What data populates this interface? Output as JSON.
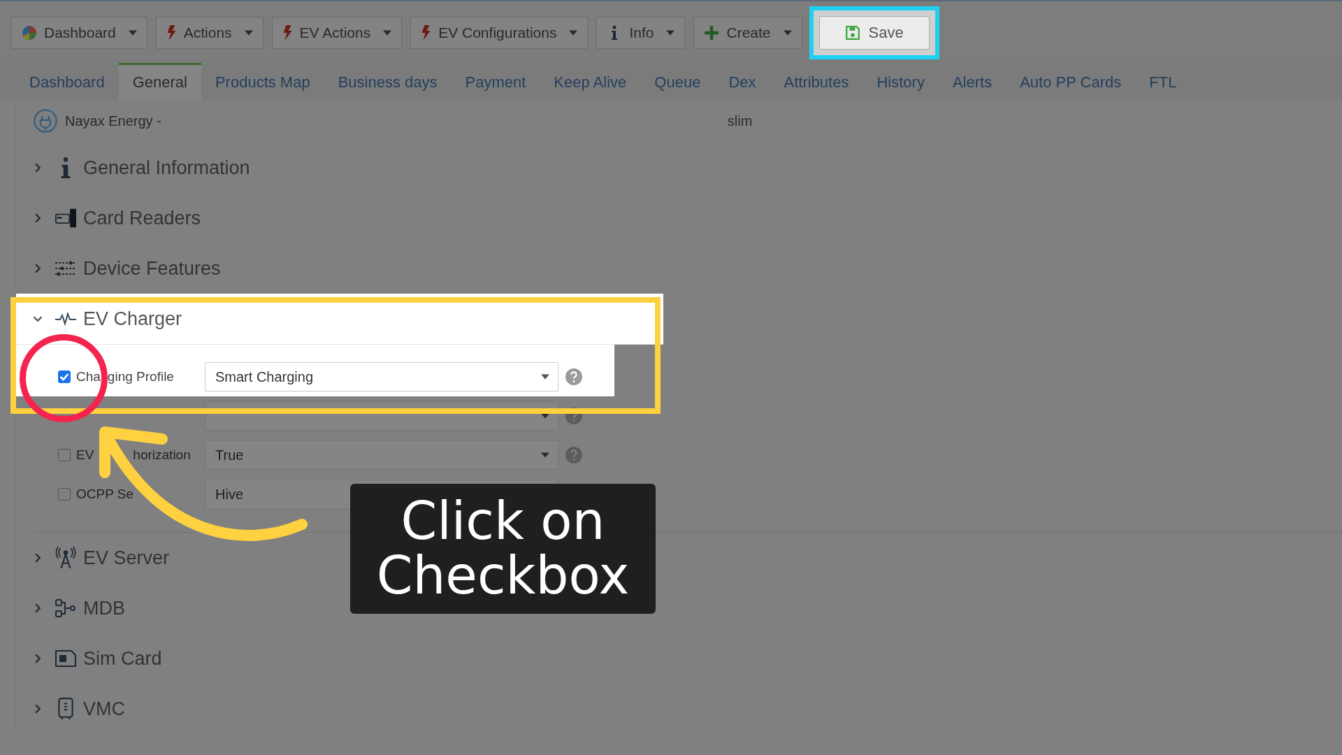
{
  "toolbar": [
    {
      "label": "Dashboard"
    },
    {
      "label": "Actions"
    },
    {
      "label": "EV Actions"
    },
    {
      "label": "EV Configurations"
    },
    {
      "label": "Info"
    },
    {
      "label": "Create"
    }
  ],
  "save_button": {
    "label": "Save"
  },
  "tabs": [
    {
      "label": "Dashboard",
      "selected": false
    },
    {
      "label": "General",
      "selected": true
    },
    {
      "label": "Products Map",
      "selected": false
    },
    {
      "label": "Business days",
      "selected": false
    },
    {
      "label": "Payment",
      "selected": false
    },
    {
      "label": "Keep Alive",
      "selected": false
    },
    {
      "label": "Queue",
      "selected": false
    },
    {
      "label": "Dex",
      "selected": false
    },
    {
      "label": "Attributes",
      "selected": false
    },
    {
      "label": "History",
      "selected": false
    },
    {
      "label": "Alerts",
      "selected": false
    },
    {
      "label": "Auto PP Cards",
      "selected": false
    },
    {
      "label": "FTL",
      "selected": false
    }
  ],
  "device": {
    "name": "Nayax Energy -",
    "model": "slim"
  },
  "sections": [
    {
      "title": "General Information",
      "expanded": false
    },
    {
      "title": "Card Readers",
      "expanded": false
    },
    {
      "title": "Device Features",
      "expanded": false
    },
    {
      "title": "EV Charger",
      "expanded": true,
      "fields": [
        {
          "kind": "option",
          "label_parts": [
            "Cha",
            "ging Profile"
          ],
          "checked": true,
          "value": "Smart Charging"
        },
        {
          "kind": "covered"
        },
        {
          "kind": "option",
          "label_parts": [
            "EV",
            "horization"
          ],
          "checked": false,
          "value": "True"
        },
        {
          "kind": "option",
          "label_parts": [
            "OCPP Se"
          ],
          "checked": false,
          "value": "Hive"
        }
      ]
    },
    {
      "title": "EV Server",
      "expanded": false
    },
    {
      "title": "MDB",
      "expanded": false
    },
    {
      "title": "Sim Card",
      "expanded": false
    },
    {
      "title": "VMC",
      "expanded": false
    }
  ],
  "callout": {
    "text": "Click on Checkbox"
  }
}
